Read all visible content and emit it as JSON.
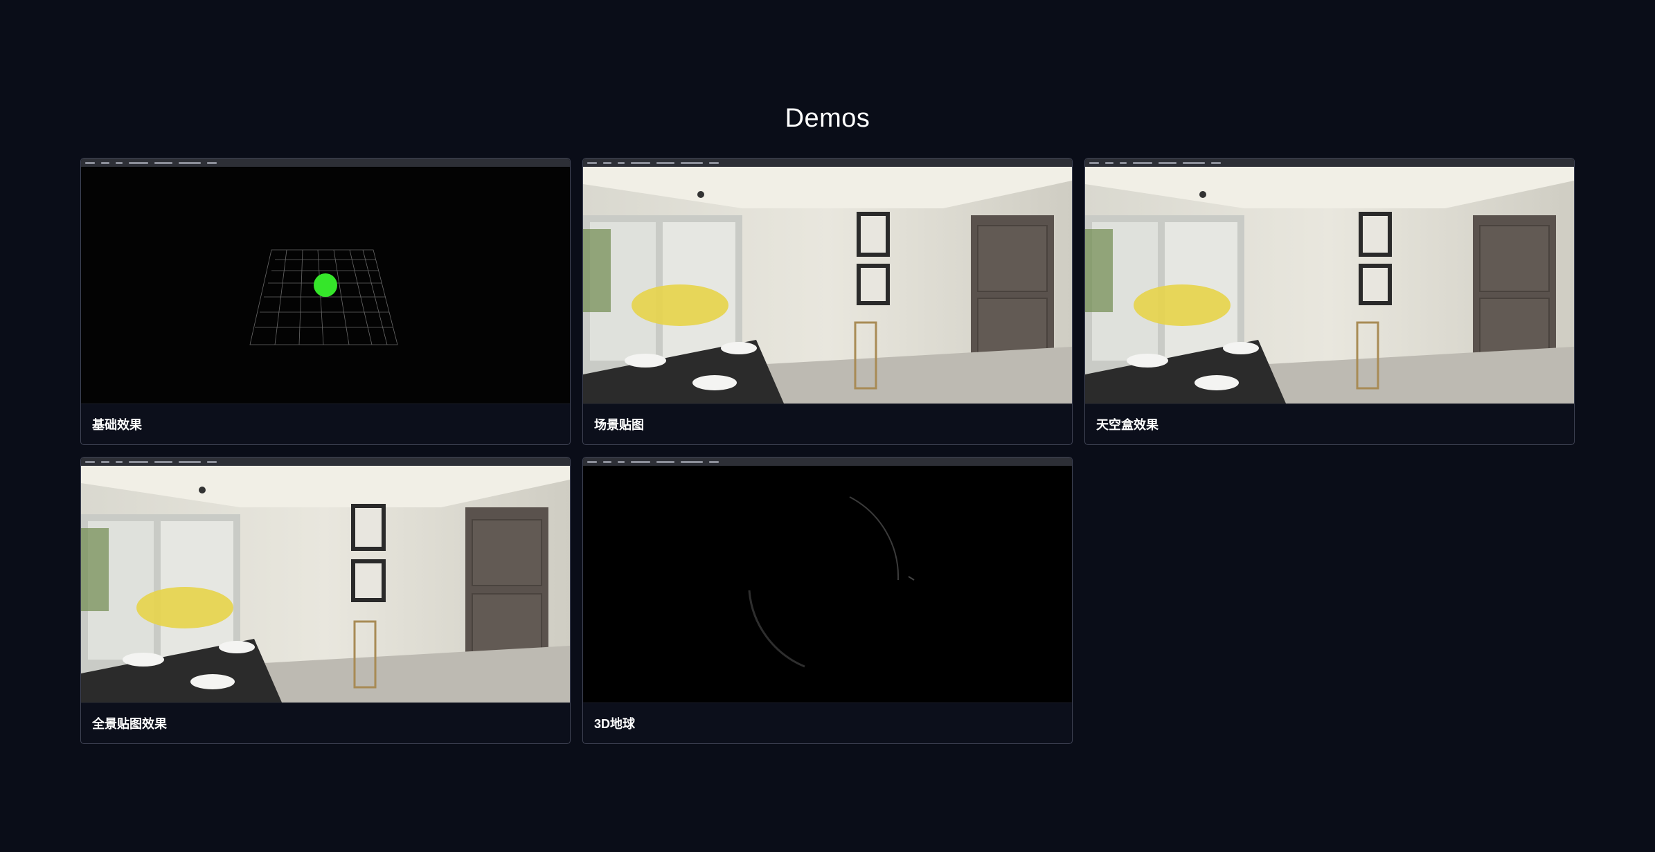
{
  "page": {
    "title": "Demos"
  },
  "demos": [
    {
      "label": "基础效果",
      "thumbnail": "grid-sphere"
    },
    {
      "label": "场景贴图",
      "thumbnail": "dining-room"
    },
    {
      "label": "天空盒效果",
      "thumbnail": "dining-room"
    },
    {
      "label": "全景贴图效果",
      "thumbnail": "dining-room"
    },
    {
      "label": "3D地球",
      "thumbnail": "dark-earth"
    }
  ],
  "colors": {
    "background": "#0a0d18",
    "card_border": "#3f4354",
    "sphere": "#35e62a"
  }
}
